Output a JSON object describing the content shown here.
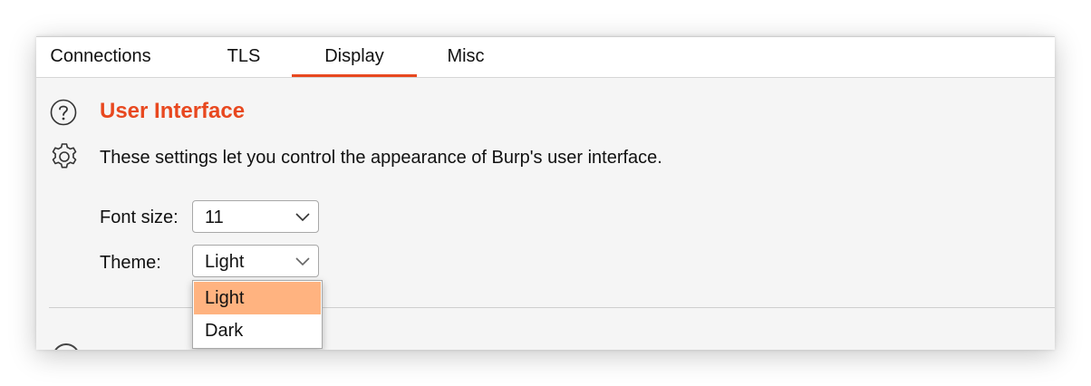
{
  "tabs": [
    {
      "label": "Connections"
    },
    {
      "label": "TLS"
    },
    {
      "label": "Display"
    },
    {
      "label": "Misc"
    }
  ],
  "active_tab": "Display",
  "section": {
    "title": "User Interface",
    "description": "These settings let you control the appearance of Burp's user interface."
  },
  "font_size": {
    "label": "Font size:",
    "value": "11"
  },
  "theme": {
    "label": "Theme:",
    "value": "Light",
    "options": [
      "Light",
      "Dark"
    ],
    "highlighted_option": "Light"
  },
  "colors": {
    "accent": "#e8481f",
    "highlight": "#ffb380"
  },
  "icons": {
    "help": "help-circle-icon",
    "settings": "gear-icon",
    "dropdown": "chevron-down-icon"
  }
}
